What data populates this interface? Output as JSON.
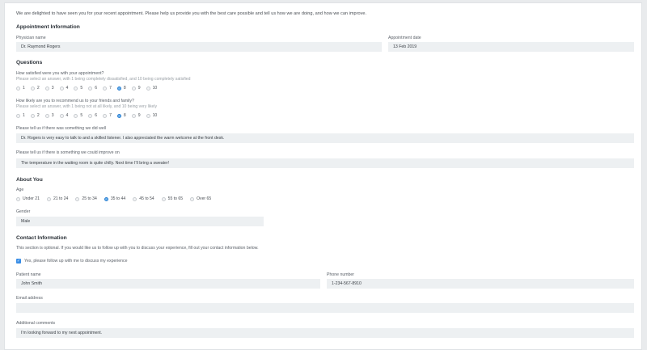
{
  "intro": "We are delighted to have seen you for your recent appointment. Please help us provide you with the best care possible and tell us how we are doing, and how we can improve.",
  "appointment": {
    "heading": "Appointment Information",
    "physician_label": "Physician name",
    "physician_value": "Dr. Raymond Rogers",
    "date_label": "Appointment date",
    "date_value": "13 Feb 2019"
  },
  "questions": {
    "heading": "Questions",
    "q1": {
      "label": "How satisfied were you with your appointment?",
      "hint": "Please select an answer, with 1 being completely dissatisfied, and 10 being completely satisfied",
      "options": [
        "1",
        "2",
        "3",
        "4",
        "5",
        "6",
        "7",
        "8",
        "9",
        "10"
      ],
      "selected": "8"
    },
    "q2": {
      "label": "How likely are you to recommend us to your friends and family?",
      "hint": "Please select an answer, with 1 being not at all likely, and 10 being very likely",
      "options": [
        "1",
        "2",
        "3",
        "4",
        "5",
        "6",
        "7",
        "8",
        "9",
        "10"
      ],
      "selected": "8"
    },
    "did_well_label": "Please tell us if there was something we did well",
    "did_well_value": "Dr. Rogers is very easy to talk to and a skilled listener. I also appreciated the warm welcome at the front desk.",
    "improve_label": "Please tell us if there is something we could improve on",
    "improve_value": "The temperature in the waiting room is quite chilly. Next time I'll bring a sweater!"
  },
  "about": {
    "heading": "About You",
    "age_label": "Age",
    "age_options": [
      "Under 21",
      "21 to 24",
      "25 to 34",
      "35 to 44",
      "45 to 54",
      "55 to 65",
      "Over 65"
    ],
    "age_selected": "35 to 44",
    "gender_label": "Gender",
    "gender_value": "Male"
  },
  "contact": {
    "heading": "Contact Information",
    "note": "This section is optional. If you would like us to follow up with you to discuss your experience, fill out your contact information below.",
    "follow_up_label": "Yes, please follow up with me to discuss my experience",
    "follow_up_checked": true,
    "patient_label": "Patient name",
    "patient_value": "John Smith",
    "phone_label": "Phone number",
    "phone_value": "1-234-567-8910",
    "email_label": "Email address",
    "email_value": "",
    "comments_label": "Additional comments",
    "comments_value": "I'm looking forward to my next appointment."
  },
  "colors": {
    "accent": "#3a8ee6",
    "field_bg": "#edf0f2"
  }
}
